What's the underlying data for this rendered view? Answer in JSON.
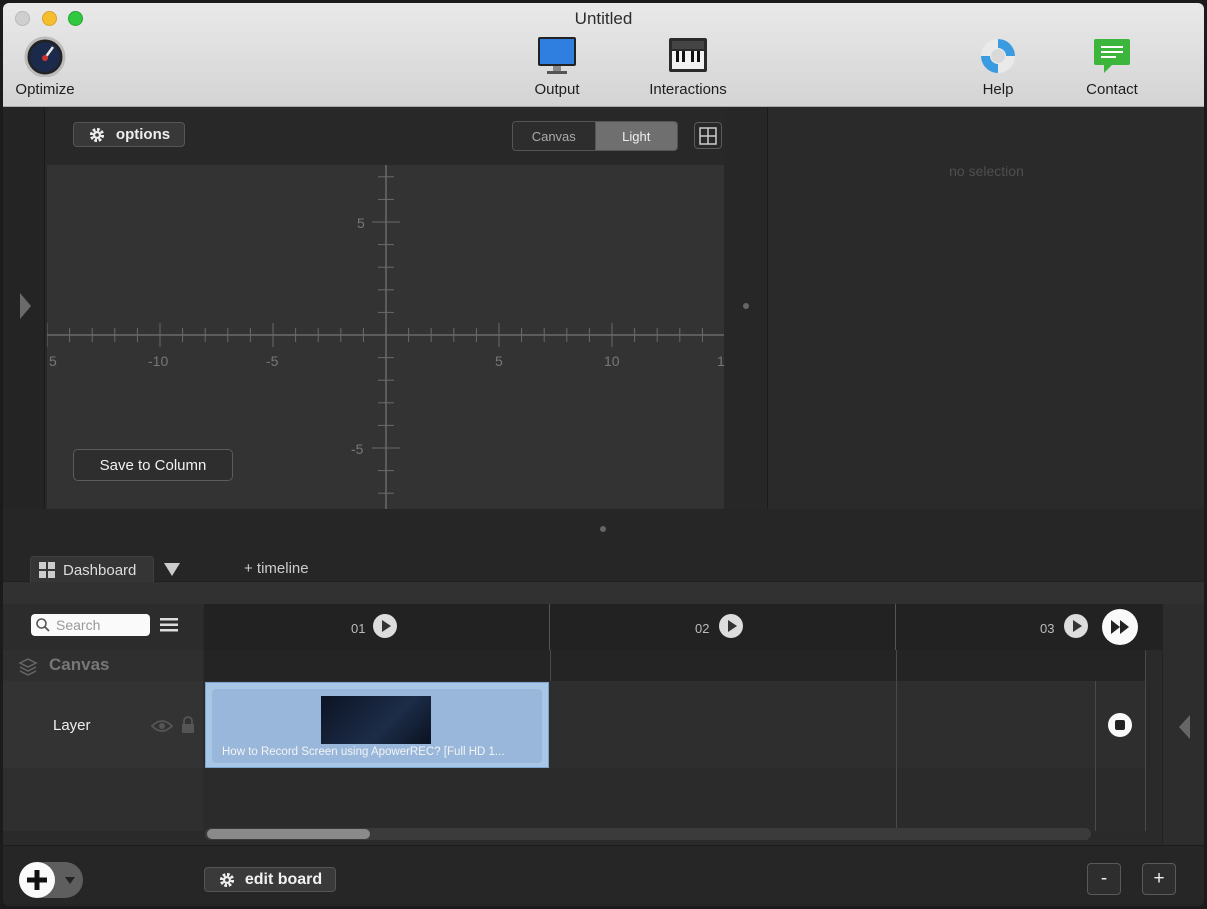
{
  "window": {
    "title": "Untitled"
  },
  "toolbar": {
    "optimize": "Optimize",
    "output": "Output",
    "interactions": "Interactions",
    "help": "Help",
    "contact": "Contact"
  },
  "stage": {
    "options_label": "options",
    "segment": [
      "Canvas",
      "Light"
    ],
    "segment_selected": "Light",
    "save_to_column": "Save to Column",
    "axis": {
      "x_ticks": [
        "5",
        "-10",
        "-5",
        "5",
        "10",
        "1"
      ],
      "y_ticks": [
        "5",
        "-5"
      ]
    }
  },
  "inspector": {
    "empty_text": "no selection"
  },
  "tabs": {
    "dashboard": "Dashboard",
    "add_timeline": "+ timeline"
  },
  "timeline": {
    "search_placeholder": "Search",
    "columns": [
      "01",
      "02",
      "03"
    ],
    "canvas_label": "Canvas",
    "layer_label": "Layer",
    "clip_title": "How to Record Screen using ApowerREC? [Full HD 1..."
  },
  "bottom": {
    "edit_board": "edit board",
    "zoom_out": "-",
    "zoom_in": "+"
  }
}
